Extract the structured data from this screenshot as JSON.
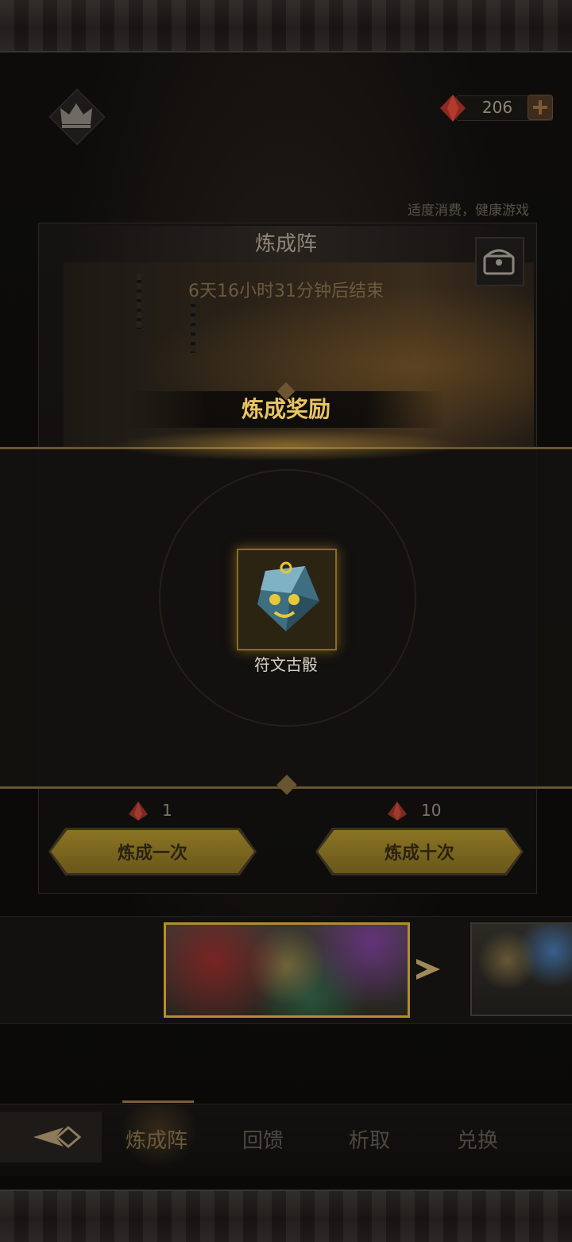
{
  "top_bar": {
    "gem_count": "206",
    "notice": "适度消费，健康游戏"
  },
  "panel": {
    "title": "炼成阵",
    "timer": "6天16小时31分钟后结束"
  },
  "reward": {
    "header": "炼成奖励",
    "item_name": "符文古骰"
  },
  "actions": [
    {
      "cost": "1",
      "label": "炼成一次"
    },
    {
      "cost": "10",
      "label": "炼成十次"
    }
  ],
  "nav": {
    "items": [
      "炼成阵",
      "回馈",
      "析取",
      "兑换"
    ],
    "active": "炼成阵"
  },
  "colors": {
    "accent_gold": "#e8c464",
    "button_gold": "#8a7424",
    "gem_red": "#8c2a22"
  }
}
